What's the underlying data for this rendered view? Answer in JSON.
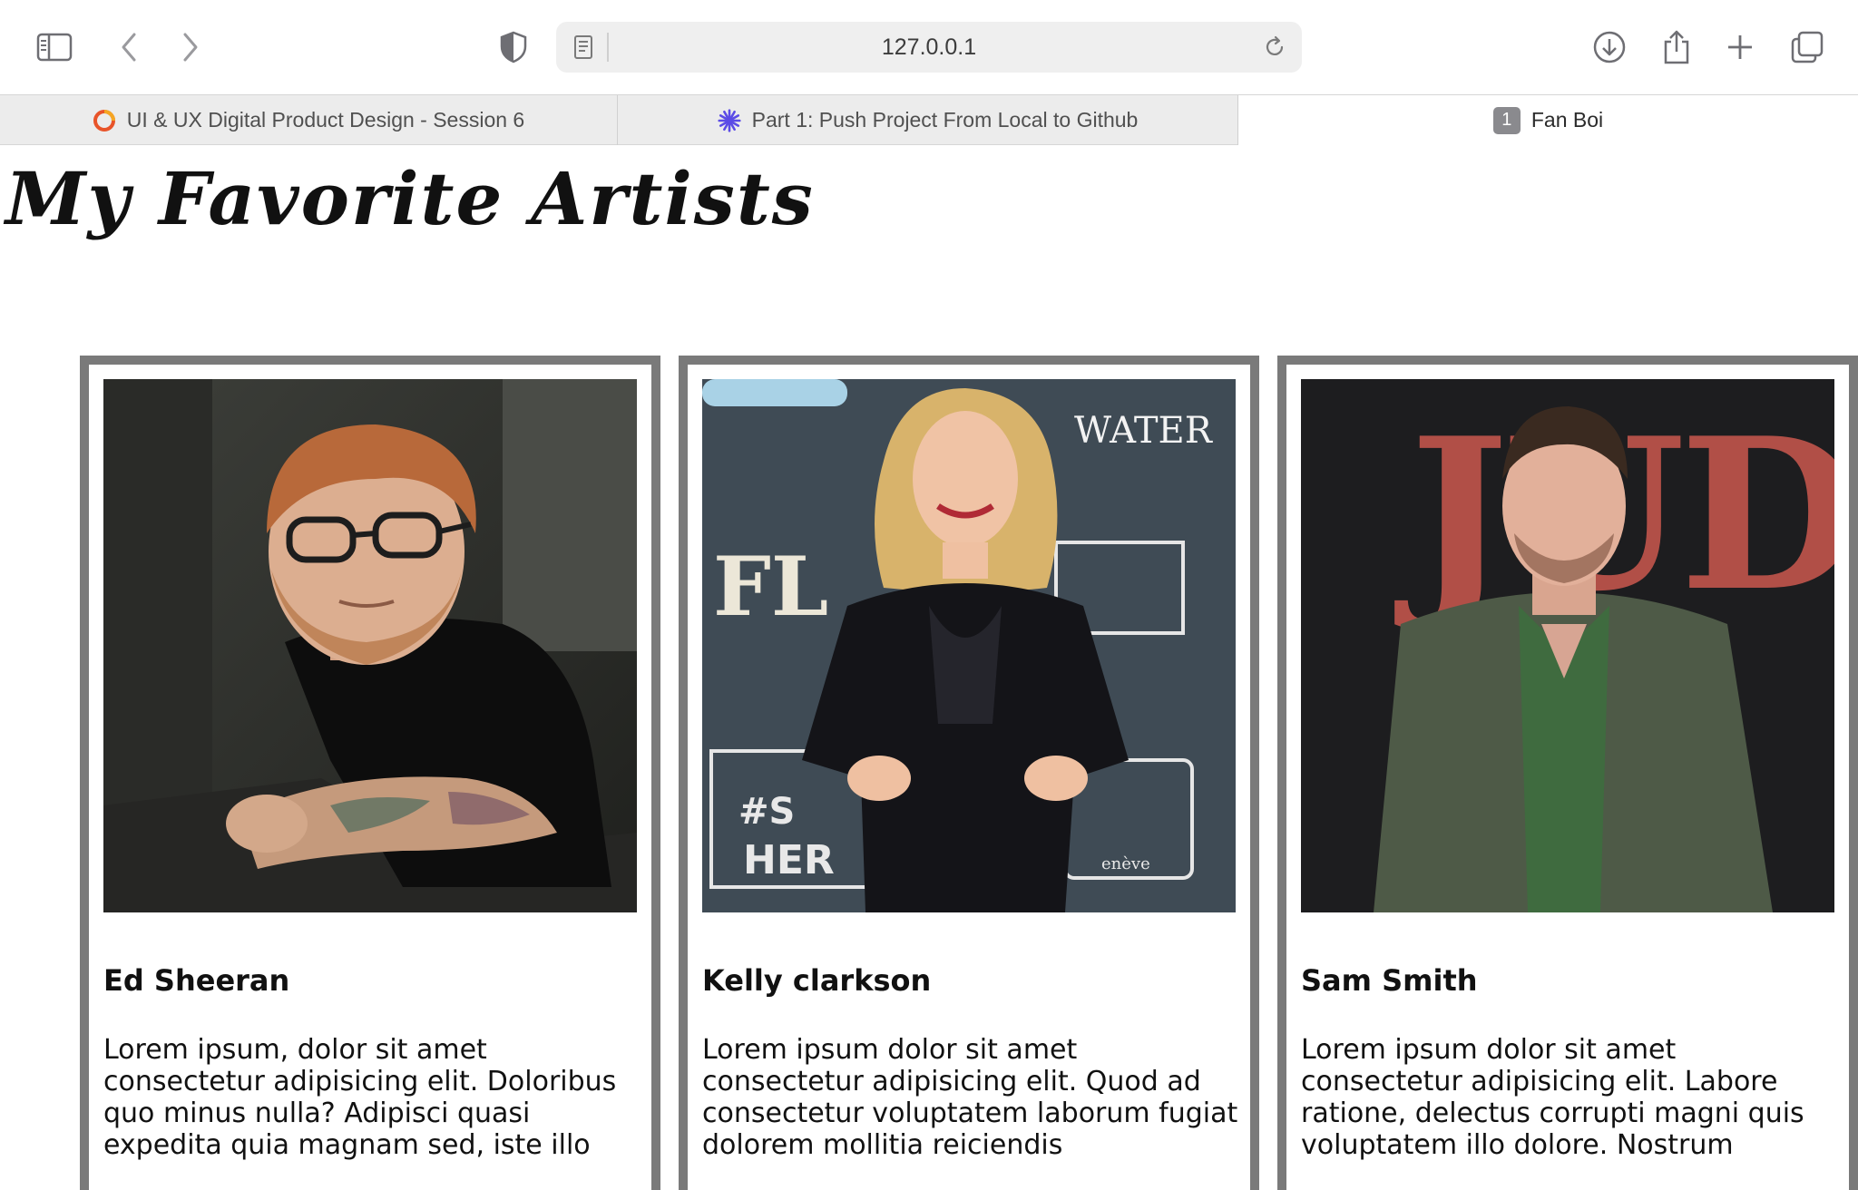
{
  "browser": {
    "url": "127.0.0.1",
    "tabs": [
      {
        "label": "UI & UX Digital Product Design - Session 6",
        "icon": "swirl-logo-icon"
      },
      {
        "label": "Part 1: Push Project From Local to Github",
        "icon": "asterisk-logo-icon"
      },
      {
        "label": "Fan Boi",
        "badge": "1",
        "active": true
      }
    ]
  },
  "page": {
    "title": "My Favorite Artists",
    "cards": [
      {
        "name": "Ed Sheeran",
        "text": "Lorem ipsum, dolor sit amet consectetur adipisicing elit. Doloribus quo minus nulla? Adipisci quasi expedita quia magnam sed, iste illo"
      },
      {
        "name": "Kelly clarkson",
        "text": "Lorem ipsum dolor sit amet consectetur adipisicing elit. Quod ad consectetur voluptatem laborum fugiat dolorem mollitia reiciendis"
      },
      {
        "name": "Sam Smith",
        "text": "Lorem ipsum dolor sit amet consectetur adipisicing elit. Labore ratione, delectus corrupti magni quis voluptatem illo dolore. Nostrum"
      }
    ]
  },
  "photo_signage": {
    "kelly": [
      "WATER",
      "HER",
      "#S",
      "enève"
    ],
    "sam": [
      "JUDY"
    ]
  },
  "colors": {
    "card_border": "#7a7a7a",
    "tab_active_bg": "#ffffff",
    "tab_inactive_bg": "#ececec",
    "address_bg": "#efefef"
  }
}
